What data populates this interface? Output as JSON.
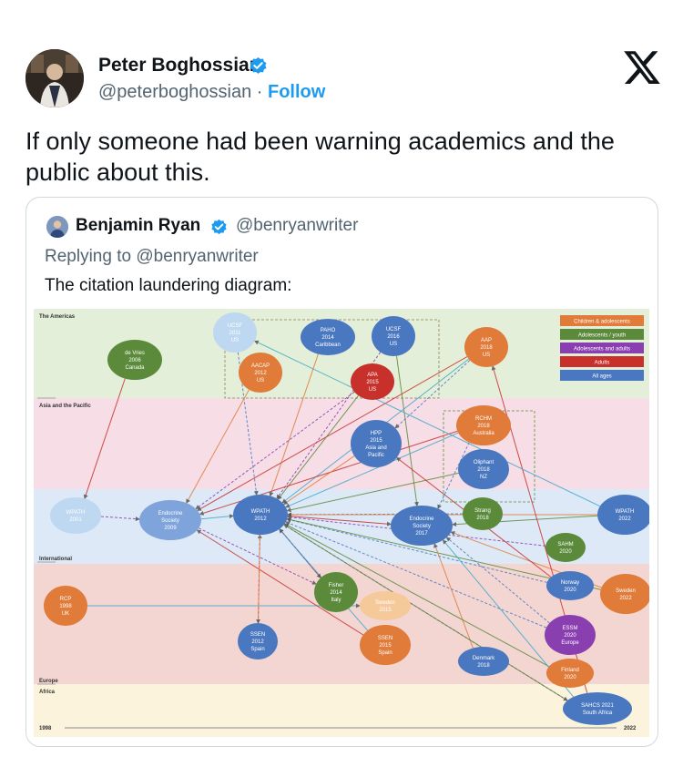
{
  "tweet": {
    "author_name": "Peter Boghossian",
    "handle": "@peterboghossian",
    "separator": "·",
    "follow_label": "Follow",
    "text": "If only someone had been warning academics and the public about this."
  },
  "quote": {
    "author_name": "Benjamin Ryan",
    "handle": "@benryanwriter",
    "reply_prefix": "Replying to",
    "reply_handle": "@benryanwriter",
    "text": "The citation laundering diagram:"
  },
  "diagram": {
    "regions": [
      "The Americas",
      "Asia and the Pacific",
      "International",
      "Europe",
      "Africa"
    ],
    "axis": {
      "start": "1998",
      "end": "2022"
    },
    "legend": [
      {
        "label": "Children & adolescents",
        "color": "#e07b39"
      },
      {
        "label": "Adolescents / youth",
        "color": "#5a8a3a"
      },
      {
        "label": "Adolescents and adults",
        "color": "#8a3fb0"
      },
      {
        "label": "Adults",
        "color": "#c8302c"
      },
      {
        "label": "All ages",
        "color": "#4a78c0"
      }
    ],
    "nodes": [
      {
        "id": "ucsf2011",
        "lines": [
          "UCSF",
          "2011",
          "US"
        ],
        "color": "#bdd8f0"
      },
      {
        "id": "paho2014",
        "lines": [
          "PAHO",
          "2014",
          "Caribbean"
        ],
        "color": "#4a78c0"
      },
      {
        "id": "ucsf2016",
        "lines": [
          "UCSF",
          "2016",
          "US"
        ],
        "color": "#4a78c0"
      },
      {
        "id": "aap2018",
        "lines": [
          "AAP",
          "2018",
          "US"
        ],
        "color": "#e07b39"
      },
      {
        "id": "devries2006",
        "lines": [
          "de Vries",
          "2006",
          "Canada"
        ],
        "color": "#5a8a3a"
      },
      {
        "id": "aacap2012",
        "lines": [
          "AACAP",
          "2012",
          "US"
        ],
        "color": "#e07b39"
      },
      {
        "id": "apa2015",
        "lines": [
          "APA",
          "2015",
          "US"
        ],
        "color": "#c8302c"
      },
      {
        "id": "rchm2018",
        "lines": [
          "RCHM",
          "2018",
          "Australia"
        ],
        "color": "#e07b39"
      },
      {
        "id": "hpp2015",
        "lines": [
          "HPP",
          "2015",
          "Asia and",
          "Pacific"
        ],
        "color": "#4a78c0"
      },
      {
        "id": "oliphant2018",
        "lines": [
          "Oliphant",
          "2018",
          "NZ"
        ],
        "color": "#4a78c0"
      },
      {
        "id": "wpath2001",
        "lines": [
          "WPATH",
          "2001"
        ],
        "color": "#bdd8f0"
      },
      {
        "id": "endo2009",
        "lines": [
          "Endocrine",
          "Society",
          "2009"
        ],
        "color": "#7fa4dc"
      },
      {
        "id": "wpath2012",
        "lines": [
          "WPATH",
          "2012"
        ],
        "color": "#4a78c0"
      },
      {
        "id": "endo2017",
        "lines": [
          "Endocrine",
          "Society",
          "2017"
        ],
        "color": "#4a78c0"
      },
      {
        "id": "strang2018",
        "lines": [
          "Strang",
          "2018"
        ],
        "color": "#5a8a3a"
      },
      {
        "id": "wpath2022",
        "lines": [
          "WPATH",
          "2022"
        ],
        "color": "#4a78c0"
      },
      {
        "id": "sahm2020",
        "lines": [
          "SAHM",
          "2020"
        ],
        "color": "#5a8a3a"
      },
      {
        "id": "rcp1998",
        "lines": [
          "RCP",
          "1998",
          "UK"
        ],
        "color": "#e07b39"
      },
      {
        "id": "fisher2014",
        "lines": [
          "Fisher",
          "2014",
          "Italy"
        ],
        "color": "#5a8a3a"
      },
      {
        "id": "sweden2015",
        "lines": [
          "Sweden",
          "2015"
        ],
        "color": "#f5c99a"
      },
      {
        "id": "norway2020",
        "lines": [
          "Norway",
          "2020"
        ],
        "color": "#4a78c0"
      },
      {
        "id": "sweden2022",
        "lines": [
          "Sweden",
          "2022"
        ],
        "color": "#e07b39"
      },
      {
        "id": "ssen2012",
        "lines": [
          "SSEN",
          "2012",
          "Spain"
        ],
        "color": "#4a78c0"
      },
      {
        "id": "ssen2015",
        "lines": [
          "SSEN",
          "2015",
          "Spain"
        ],
        "color": "#e07b39"
      },
      {
        "id": "essm2020",
        "lines": [
          "ESSM",
          "2020",
          "Europe"
        ],
        "color": "#8a3fb0"
      },
      {
        "id": "denmark2018",
        "lines": [
          "Denmark",
          "2018"
        ],
        "color": "#4a78c0"
      },
      {
        "id": "finland2020",
        "lines": [
          "Finland",
          "2020"
        ],
        "color": "#e07b39"
      },
      {
        "id": "sahcs2021",
        "lines": [
          "SAHCS 2021",
          "South Africa"
        ],
        "color": "#4a78c0"
      }
    ],
    "edges": [
      [
        "devries2006",
        "wpath2001"
      ],
      [
        "ucsf2011",
        "wpath2012"
      ],
      [
        "paho2014",
        "wpath2012"
      ],
      [
        "ucsf2016",
        "endo2017"
      ],
      [
        "ucsf2016",
        "wpath2012"
      ],
      [
        "aap2018",
        "wpath2012"
      ],
      [
        "aap2018",
        "endo2009"
      ],
      [
        "aap2018",
        "hpp2015"
      ],
      [
        "aacap2012",
        "endo2009"
      ],
      [
        "apa2015",
        "wpath2012"
      ],
      [
        "apa2015",
        "endo2009"
      ],
      [
        "rchm2018",
        "wpath2012"
      ],
      [
        "rchm2018",
        "endo2009"
      ],
      [
        "rchm2018",
        "endo2017"
      ],
      [
        "hpp2015",
        "wpath2012"
      ],
      [
        "oliphant2018",
        "wpath2012"
      ],
      [
        "wpath2001",
        "endo2009"
      ],
      [
        "endo2009",
        "wpath2012"
      ],
      [
        "wpath2012",
        "endo2017"
      ],
      [
        "strang2018",
        "wpath2012"
      ],
      [
        "wpath2022",
        "wpath2012"
      ],
      [
        "wpath2022",
        "endo2017"
      ],
      [
        "sahm2020",
        "wpath2012"
      ],
      [
        "rcp1998",
        "sweden2015"
      ],
      [
        "fisher2014",
        "wpath2012"
      ],
      [
        "norway2020",
        "wpath2012"
      ],
      [
        "sweden2022",
        "endo2017"
      ],
      [
        "sweden2022",
        "wpath2012"
      ],
      [
        "ssen2012",
        "wpath2012"
      ],
      [
        "ssen2015",
        "wpath2012"
      ],
      [
        "ssen2015",
        "endo2009"
      ],
      [
        "essm2020",
        "wpath2012"
      ],
      [
        "denmark2018",
        "endo2017"
      ],
      [
        "finland2020",
        "wpath2012"
      ],
      [
        "sahcs2021",
        "wpath2012"
      ],
      [
        "sahcs2021",
        "endo2017"
      ],
      [
        "sahcs2021",
        "aap2018"
      ],
      [
        "wpath2012",
        "fisher2014"
      ],
      [
        "wpath2012",
        "ssen2012"
      ],
      [
        "wpath2012",
        "sahcs2021"
      ],
      [
        "endo2009",
        "fisher2014"
      ],
      [
        "wpath2022",
        "ucsf2011"
      ],
      [
        "norway2020",
        "hpp2015"
      ],
      [
        "essm2020",
        "endo2017"
      ]
    ]
  }
}
